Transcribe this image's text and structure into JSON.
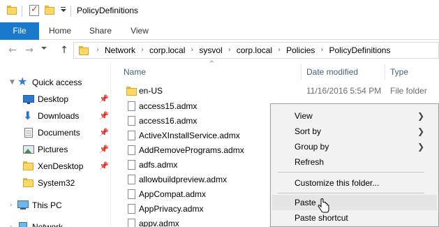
{
  "window": {
    "title": "PolicyDefinitions"
  },
  "ribbon": {
    "tabs": [
      "File",
      "Home",
      "Share",
      "View"
    ]
  },
  "address": {
    "crumbs": [
      "Network",
      "corp.local",
      "sysvol",
      "corp.local",
      "Policies",
      "PolicyDefinitions"
    ]
  },
  "nav": {
    "quick_access": "Quick access",
    "items": [
      {
        "label": "Desktop",
        "icon": "desktop-icon",
        "pinned": true
      },
      {
        "label": "Downloads",
        "icon": "downloads-icon",
        "pinned": true
      },
      {
        "label": "Documents",
        "icon": "documents-icon",
        "pinned": true
      },
      {
        "label": "Pictures",
        "icon": "pictures-icon",
        "pinned": true
      },
      {
        "label": "XenDesktop",
        "icon": "folder-icon",
        "pinned": true
      },
      {
        "label": "System32",
        "icon": "folder-icon",
        "pinned": false
      }
    ],
    "this_pc": "This PC",
    "network": "Network"
  },
  "columns": {
    "name": "Name",
    "date": "Date modified",
    "type": "Type"
  },
  "files": [
    {
      "name": "en-US",
      "date": "11/16/2016 5:54 PM",
      "type": "File folder",
      "kind": "folder"
    },
    {
      "name": "access15.admx",
      "date": "",
      "type": "",
      "kind": "file"
    },
    {
      "name": "access16.admx",
      "date": "",
      "type": "",
      "kind": "file"
    },
    {
      "name": "ActiveXInstallService.admx",
      "date": "",
      "type": "",
      "kind": "file"
    },
    {
      "name": "AddRemovePrograms.admx",
      "date": "",
      "type": "",
      "kind": "file"
    },
    {
      "name": "adfs.admx",
      "date": "",
      "type": "",
      "kind": "file"
    },
    {
      "name": "allowbuildpreview.admx",
      "date": "",
      "type": "",
      "kind": "file"
    },
    {
      "name": "AppCompat.admx",
      "date": "",
      "type": "",
      "kind": "file"
    },
    {
      "name": "AppPrivacy.admx",
      "date": "",
      "type": "",
      "kind": "file"
    },
    {
      "name": "appv.admx",
      "date": "",
      "type": "",
      "kind": "file"
    }
  ],
  "context_menu": {
    "items": [
      {
        "label": "View",
        "submenu": true
      },
      {
        "label": "Sort by",
        "submenu": true
      },
      {
        "label": "Group by",
        "submenu": true
      },
      {
        "label": "Refresh",
        "submenu": false
      },
      {
        "label": "Customize this folder...",
        "submenu": false
      },
      {
        "label": "Paste",
        "submenu": false,
        "highlighted": true
      },
      {
        "label": "Paste shortcut",
        "submenu": false
      }
    ]
  },
  "colors": {
    "file_tab": "#1979ca",
    "folder_yellow": "#ffd766",
    "header_text": "#4c607a",
    "menu_bg": "#f2f2f2",
    "menu_hover": "#e5e5e5"
  }
}
